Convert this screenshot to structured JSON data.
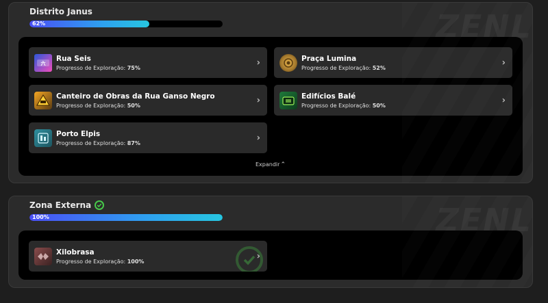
{
  "regions": [
    {
      "title": "Distrito Janus",
      "progress_text": "62%",
      "progress_value": 62,
      "completed": false,
      "expand_label": "Expandir",
      "locations": [
        {
          "name": "Rua Seis",
          "progress_label": "Progresso de Exploração:",
          "progress": "75%",
          "icon": "rua-seis-icon"
        },
        {
          "name": "Praça Lumina",
          "progress_label": "Progresso de Exploração:",
          "progress": "52%",
          "icon": "praca-lumina-icon"
        },
        {
          "name": "Canteiro de Obras da Rua Ganso Negro",
          "progress_label": "Progresso de Exploração:",
          "progress": "50%",
          "icon": "canteiro-icon"
        },
        {
          "name": "Edifícios Balé",
          "progress_label": "Progresso de Exploração:",
          "progress": "50%",
          "icon": "edificios-bale-icon"
        },
        {
          "name": "Porto Elpis",
          "progress_label": "Progresso de Exploração:",
          "progress": "87%",
          "icon": "porto-elpis-icon"
        }
      ]
    },
    {
      "title": "Zona Externa",
      "progress_text": "100%",
      "progress_value": 100,
      "completed": true,
      "locations": [
        {
          "name": "Xilobrasa",
          "progress_label": "Progresso de Exploração:",
          "progress": "100%",
          "icon": "xilobrasa-icon",
          "completed": true
        }
      ]
    }
  ],
  "watermark": "ZENL",
  "colors": {
    "progress_start": "#4a4ff5",
    "progress_end": "#27c6e0",
    "complete_green": "#47c94a",
    "card_bg": "#2a2a2a",
    "panel_bg": "#2b2b2b"
  }
}
